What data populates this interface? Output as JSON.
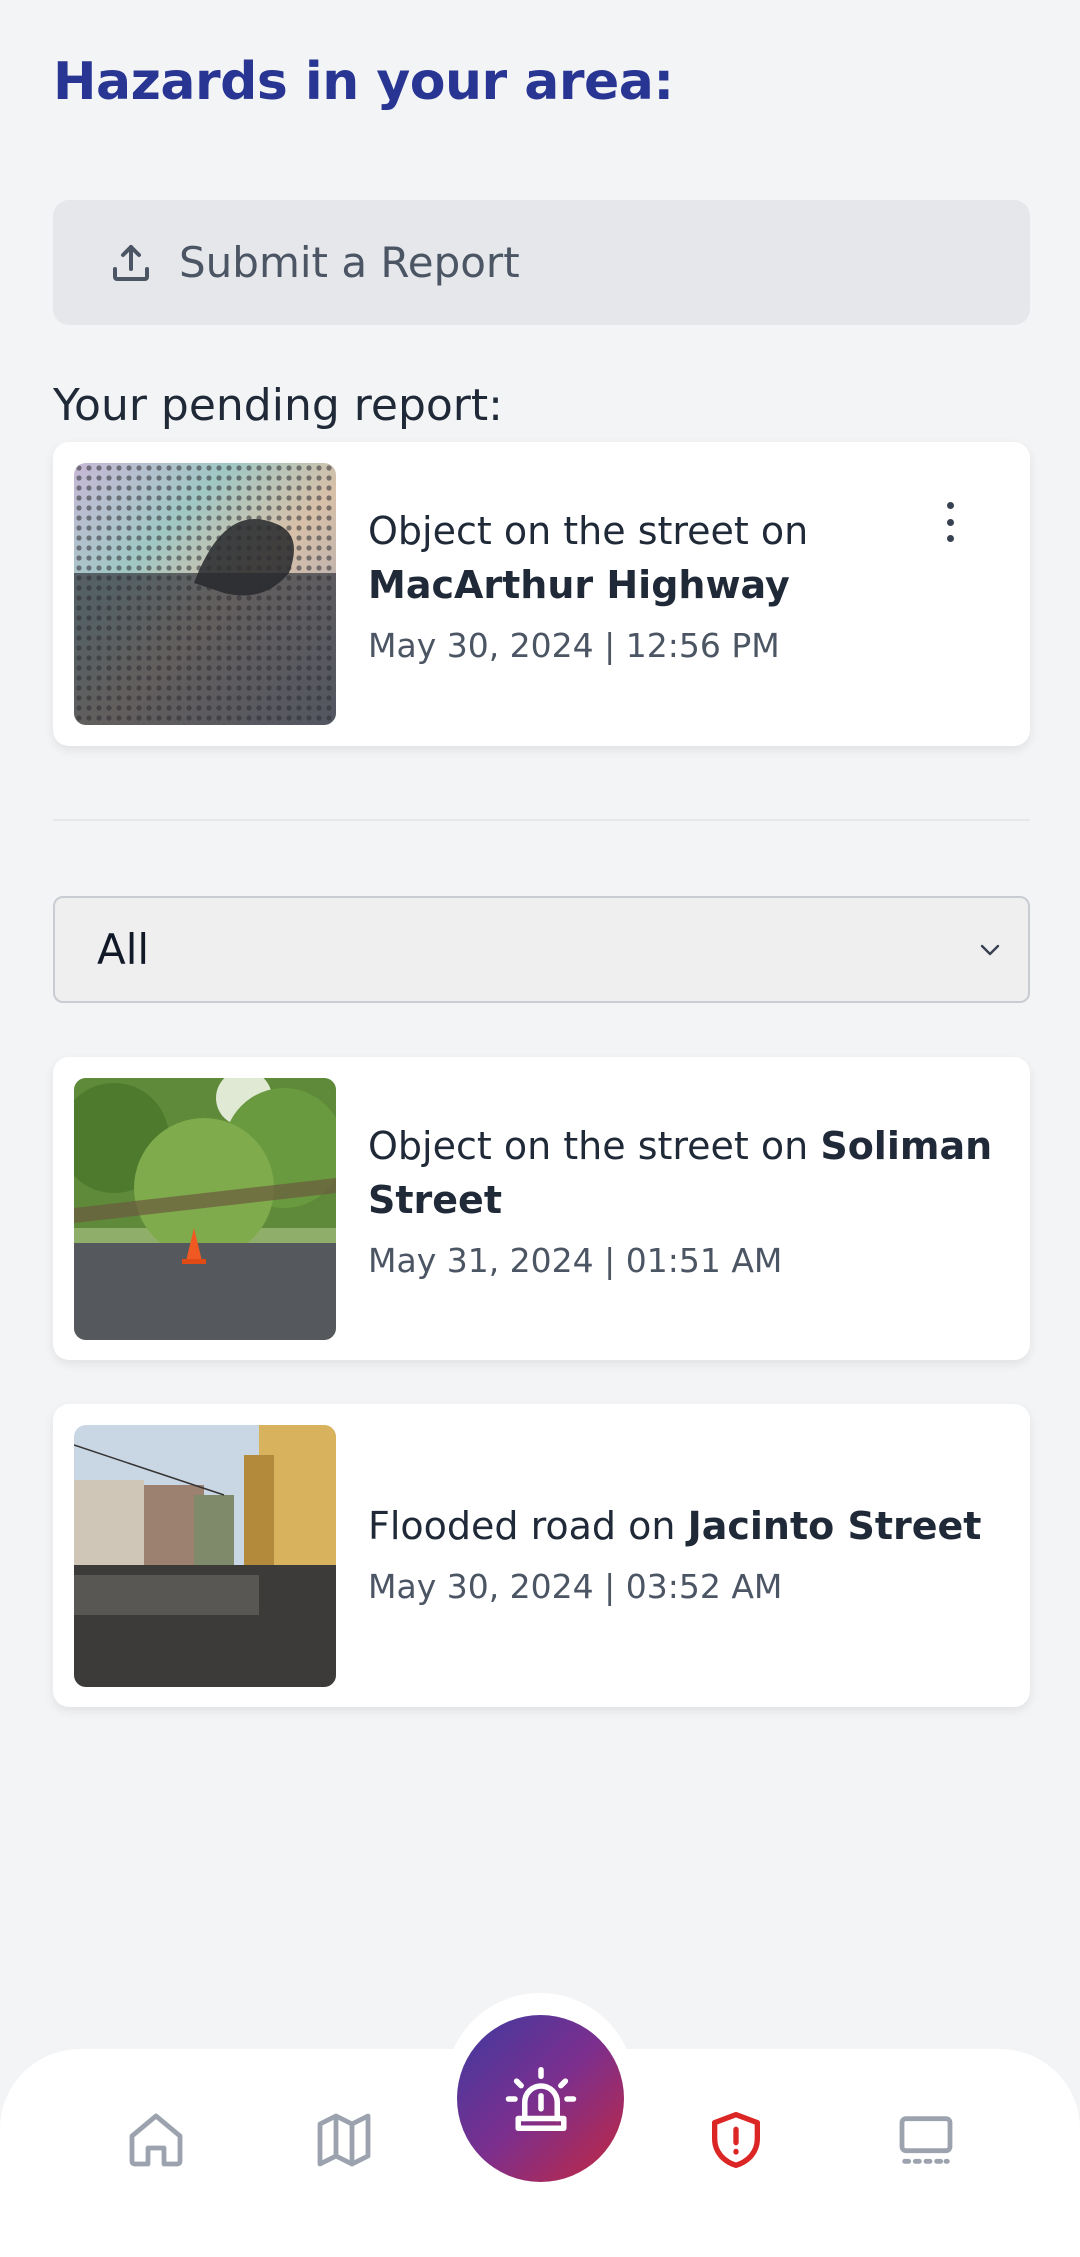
{
  "header": {
    "title": "Hazards in your area:"
  },
  "submit": {
    "label": "Submit a Report",
    "icon": "upload-icon"
  },
  "pending": {
    "label": "Your pending report:",
    "report": {
      "prefix": "Object on the street on ",
      "street": "MacArthur Highway",
      "date": "May 30, 2024 | 12:56 PM"
    }
  },
  "filter": {
    "selected": "All"
  },
  "reports": [
    {
      "prefix": "Object on the street on ",
      "street": "Soliman Street",
      "date": "May 31, 2024 | 01:51 AM"
    },
    {
      "prefix": "Flooded road on ",
      "street": "Jacinto Street",
      "date": "May 30, 2024 | 03:52 AM"
    }
  ],
  "nav": {
    "items": [
      "home-icon",
      "map-icon",
      "alarm-icon",
      "shield-alert-icon",
      "monitor-icon"
    ],
    "active": "shield-alert-icon",
    "accent": "#dc2626"
  }
}
